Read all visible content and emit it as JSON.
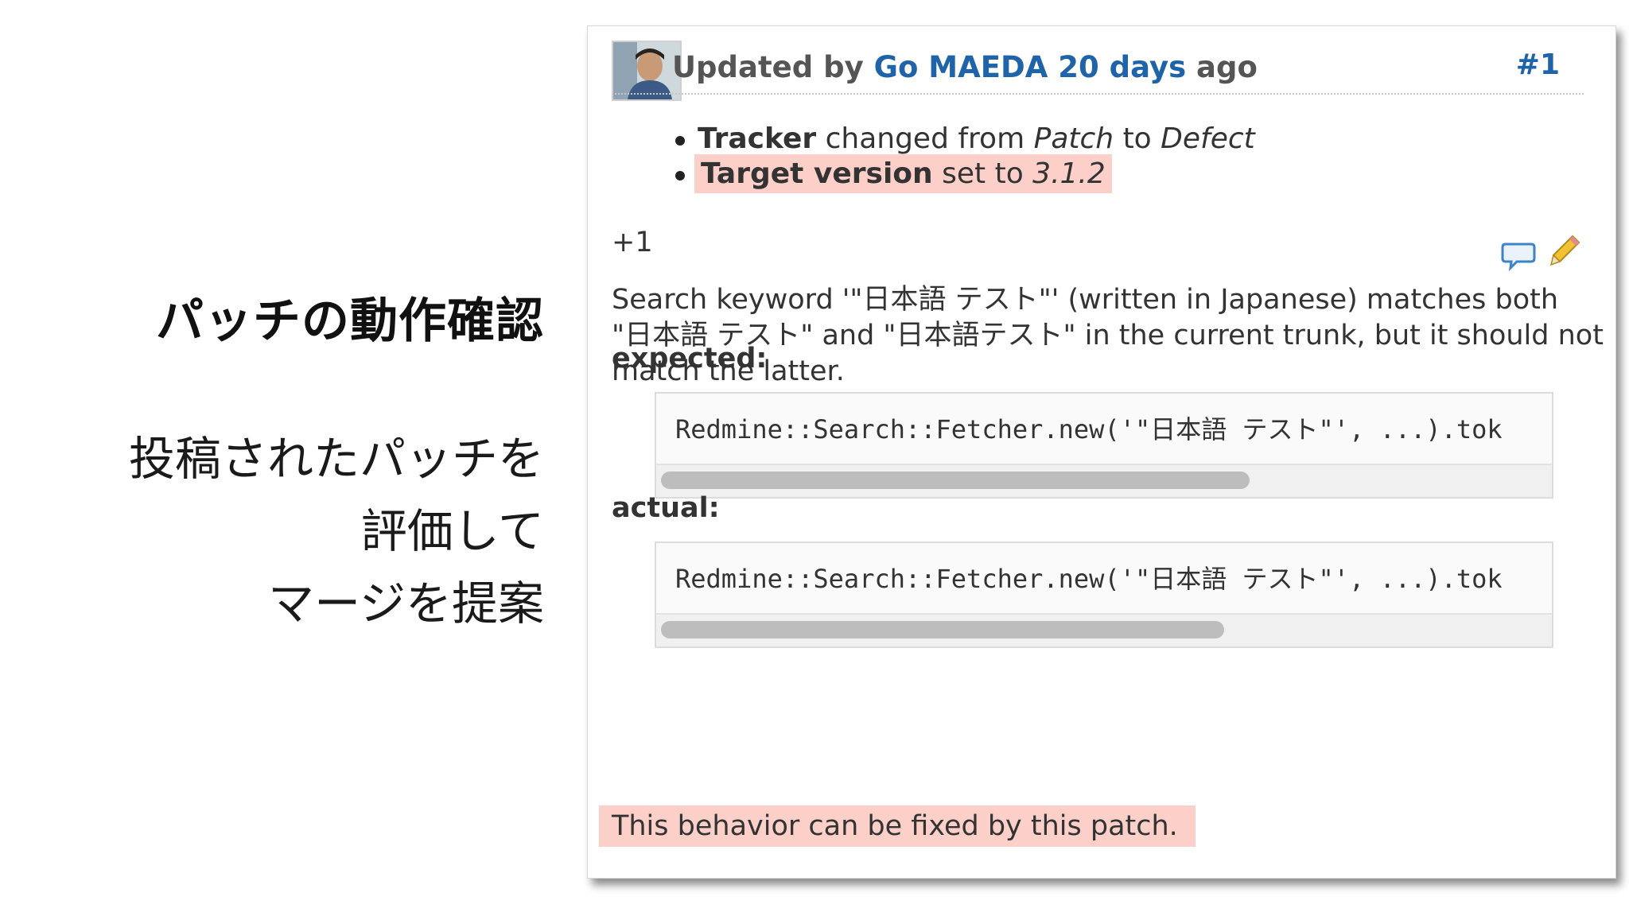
{
  "slide": {
    "title": "パッチの動作確認",
    "body_lines": [
      "投稿されたパッチを",
      "評価して",
      "マージを提案"
    ]
  },
  "journal": {
    "updated_by_prefix": "Updated by",
    "author": "Go MAEDA",
    "time_ago": "20 days",
    "ago_suffix": "ago",
    "number": "#1",
    "details": [
      {
        "field": "Tracker",
        "mid": "changed from",
        "from": "Patch",
        "to_word": "to",
        "to": "Defect"
      },
      {
        "field": "Target version",
        "mid": "set to",
        "value": "3.1.2"
      }
    ],
    "note_plus": "+1",
    "paragraph": "Search keyword '\"日本語 テスト\"' (written in Japanese) matches both \"日本語 テスト\" and \"日本語テスト\" in the current trunk, but it should not match the latter.",
    "expected_label": "expected:",
    "expected_code": "Redmine::Search::Fetcher.new('\"日本語 テスト\"', ...).tok",
    "actual_label": "actual:",
    "actual_code": "Redmine::Search::Fetcher.new('\"日本語 テスト\"', ...).tok",
    "fix_note": "This behavior can be fixed by this patch.",
    "icons": {
      "quote": "speech-bubble-icon",
      "edit": "pencil-icon",
      "avatar": "user-avatar"
    },
    "colors": {
      "link": "#1f63a8",
      "highlight": "#fcd0c8"
    }
  }
}
